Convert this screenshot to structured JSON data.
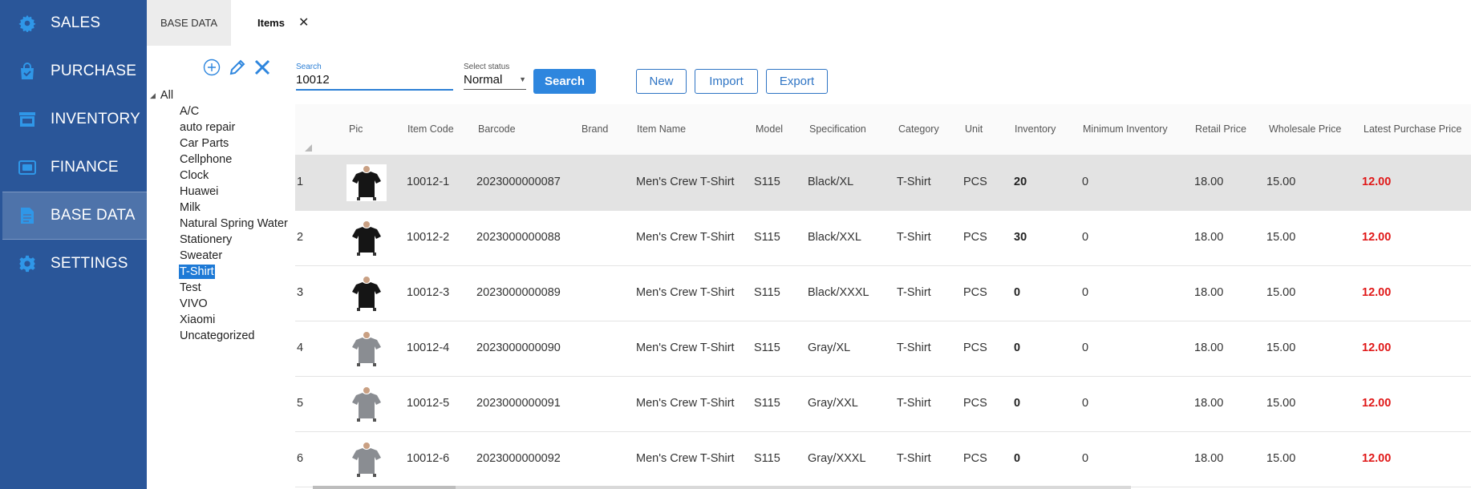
{
  "sidebar": {
    "items": [
      {
        "label": "SALES",
        "icon": "gear-icon"
      },
      {
        "label": "PURCHASE",
        "icon": "shopping-bag-icon"
      },
      {
        "label": "INVENTORY",
        "icon": "store-icon"
      },
      {
        "label": "FINANCE",
        "icon": "money-icon"
      },
      {
        "label": "BASE DATA",
        "icon": "document-icon"
      },
      {
        "label": "SETTINGS",
        "icon": "settings-icon"
      }
    ],
    "active_index": 4,
    "bg_color": "#2a5699",
    "active_color": "#4e73aa"
  },
  "tabs": {
    "base_label": "BASE DATA",
    "items_label": "Items",
    "close_glyph": "✕"
  },
  "tree": {
    "tool_icons": [
      "add-circle-icon",
      "pencil-icon",
      "delete-x-icon"
    ],
    "root_label": "All",
    "nodes": [
      "A/C",
      "auto repair",
      "Car Parts",
      "Cellphone",
      "Clock",
      "Huawei",
      "Milk",
      "Natural Spring Water",
      "Stationery",
      "Sweater",
      "T-Shirt",
      "Test",
      "VIVO",
      "Xiaomi",
      "Uncategorized"
    ],
    "selected": "T-Shirt"
  },
  "filter": {
    "search_label": "Search",
    "search_value": "10012",
    "status_label": "Select status",
    "status_value": "Normal",
    "search_button": "Search",
    "new_button": "New",
    "import_button": "Import",
    "export_button": "Export",
    "accent_color": "#2e86de"
  },
  "table": {
    "columns": [
      "Pic",
      "Item Code",
      "Barcode",
      "Brand",
      "Item Name",
      "Model",
      "Specification",
      "Category",
      "Unit",
      "Inventory",
      "Minimum Inventory",
      "Retail Price",
      "Wholesale Price",
      "Latest Purchase Price"
    ],
    "rows": [
      {
        "no": "1",
        "code": "10012-1",
        "barcode": "2023000000087",
        "brand": "",
        "name": "Men's Crew T-Shirt",
        "model": "S115",
        "spec": "Black/XL",
        "category": "T-Shirt",
        "unit": "PCS",
        "inventory": "20",
        "min_inventory": "0",
        "retail": "18.00",
        "wholesale": "15.00",
        "latest": "12.00",
        "shirt_color": "black"
      },
      {
        "no": "2",
        "code": "10012-2",
        "barcode": "2023000000088",
        "brand": "",
        "name": "Men's Crew T-Shirt",
        "model": "S115",
        "spec": "Black/XXL",
        "category": "T-Shirt",
        "unit": "PCS",
        "inventory": "30",
        "min_inventory": "0",
        "retail": "18.00",
        "wholesale": "15.00",
        "latest": "12.00",
        "shirt_color": "black"
      },
      {
        "no": "3",
        "code": "10012-3",
        "barcode": "2023000000089",
        "brand": "",
        "name": "Men's Crew T-Shirt",
        "model": "S115",
        "spec": "Black/XXXL",
        "category": "T-Shirt",
        "unit": "PCS",
        "inventory": "0",
        "min_inventory": "0",
        "retail": "18.00",
        "wholesale": "15.00",
        "latest": "12.00",
        "shirt_color": "black"
      },
      {
        "no": "4",
        "code": "10012-4",
        "barcode": "2023000000090",
        "brand": "",
        "name": "Men's Crew T-Shirt",
        "model": "S115",
        "spec": "Gray/XL",
        "category": "T-Shirt",
        "unit": "PCS",
        "inventory": "0",
        "min_inventory": "0",
        "retail": "18.00",
        "wholesale": "15.00",
        "latest": "12.00",
        "shirt_color": "gray"
      },
      {
        "no": "5",
        "code": "10012-5",
        "barcode": "2023000000091",
        "brand": "",
        "name": "Men's Crew T-Shirt",
        "model": "S115",
        "spec": "Gray/XXL",
        "category": "T-Shirt",
        "unit": "PCS",
        "inventory": "0",
        "min_inventory": "0",
        "retail": "18.00",
        "wholesale": "15.00",
        "latest": "12.00",
        "shirt_color": "gray"
      },
      {
        "no": "6",
        "code": "10012-6",
        "barcode": "2023000000092",
        "brand": "",
        "name": "Men's Crew T-Shirt",
        "model": "S115",
        "spec": "Gray/XXXL",
        "category": "T-Shirt",
        "unit": "PCS",
        "inventory": "0",
        "min_inventory": "0",
        "retail": "18.00",
        "wholesale": "15.00",
        "latest": "12.00",
        "shirt_color": "gray"
      }
    ],
    "price_color": "#e01818",
    "selected_row_color": "#e3e3e3"
  }
}
